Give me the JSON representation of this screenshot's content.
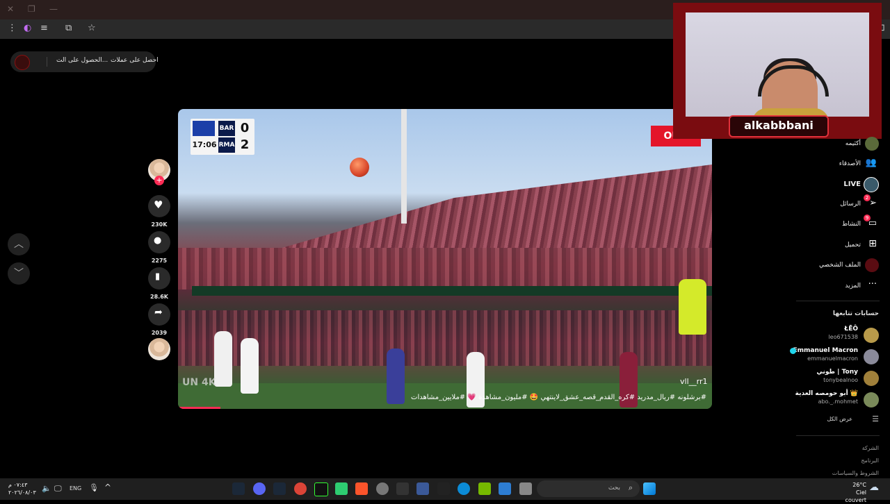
{
  "coin_bar": {
    "get_coins": "احصل على عملات",
    "get_app": "الحصول على الت..."
  },
  "video": {
    "scoreboard": {
      "team1": "BAR",
      "team2": "RMA",
      "score1": "0",
      "score2": "2",
      "clock": "17:06"
    },
    "badge": "OUN",
    "watermark": "vll__rr1",
    "left_watermark": "UN 4K",
    "caption": "#برشلونه #ريال_مدريد #كره_القدم_قصه_عشق_لاينتهي 🤩 #مليون_مشاهدة 💗 #ملايين_مشاهدات",
    "progress_fraction": 0.08
  },
  "actions": {
    "likes": "230K",
    "comments": "2275",
    "saves": "28.6K",
    "shares": "2039"
  },
  "webcam": {
    "name": "alkabbbani"
  },
  "sidebar": {
    "items": [
      {
        "label": "أكثيمه",
        "icon": "avatar-icon"
      },
      {
        "label": "الأصدقاء",
        "icon": "friends-icon"
      },
      {
        "label": "LIVE",
        "icon": "live-icon"
      },
      {
        "label": "الرسائل",
        "icon": "messages-icon",
        "badge": "2"
      },
      {
        "label": "النشاط",
        "icon": "activity-icon",
        "badge": "9"
      },
      {
        "label": "تحميل",
        "icon": "upload-icon"
      },
      {
        "label": "الملف الشخصي",
        "icon": "profile-icon"
      },
      {
        "label": "المزيد",
        "icon": "more-icon"
      }
    ],
    "following_title": "حسابات تتابعها",
    "accounts": [
      {
        "name": "ŁĒÔ",
        "username": "leo671538"
      },
      {
        "name": "Emmanuel Macron",
        "username": "emmanuelmacron"
      },
      {
        "name": "طوني | Tony",
        "username": "tonybealnoo"
      },
      {
        "name": "أبو حومصه العدية 👑",
        "username": "abo._.mohmet"
      }
    ],
    "see_all": "عرض الكل",
    "footer": [
      "الشركة",
      "البرنامج",
      "الشروط والسياسات"
    ]
  },
  "taskbar": {
    "search_placeholder": "بحث",
    "lang": "ENG",
    "time": "٠٧:٤٣ م",
    "date": "٢٠٢٦/٠٨/٠٣",
    "temp": "26°C",
    "weather": "Ciel couvert"
  }
}
